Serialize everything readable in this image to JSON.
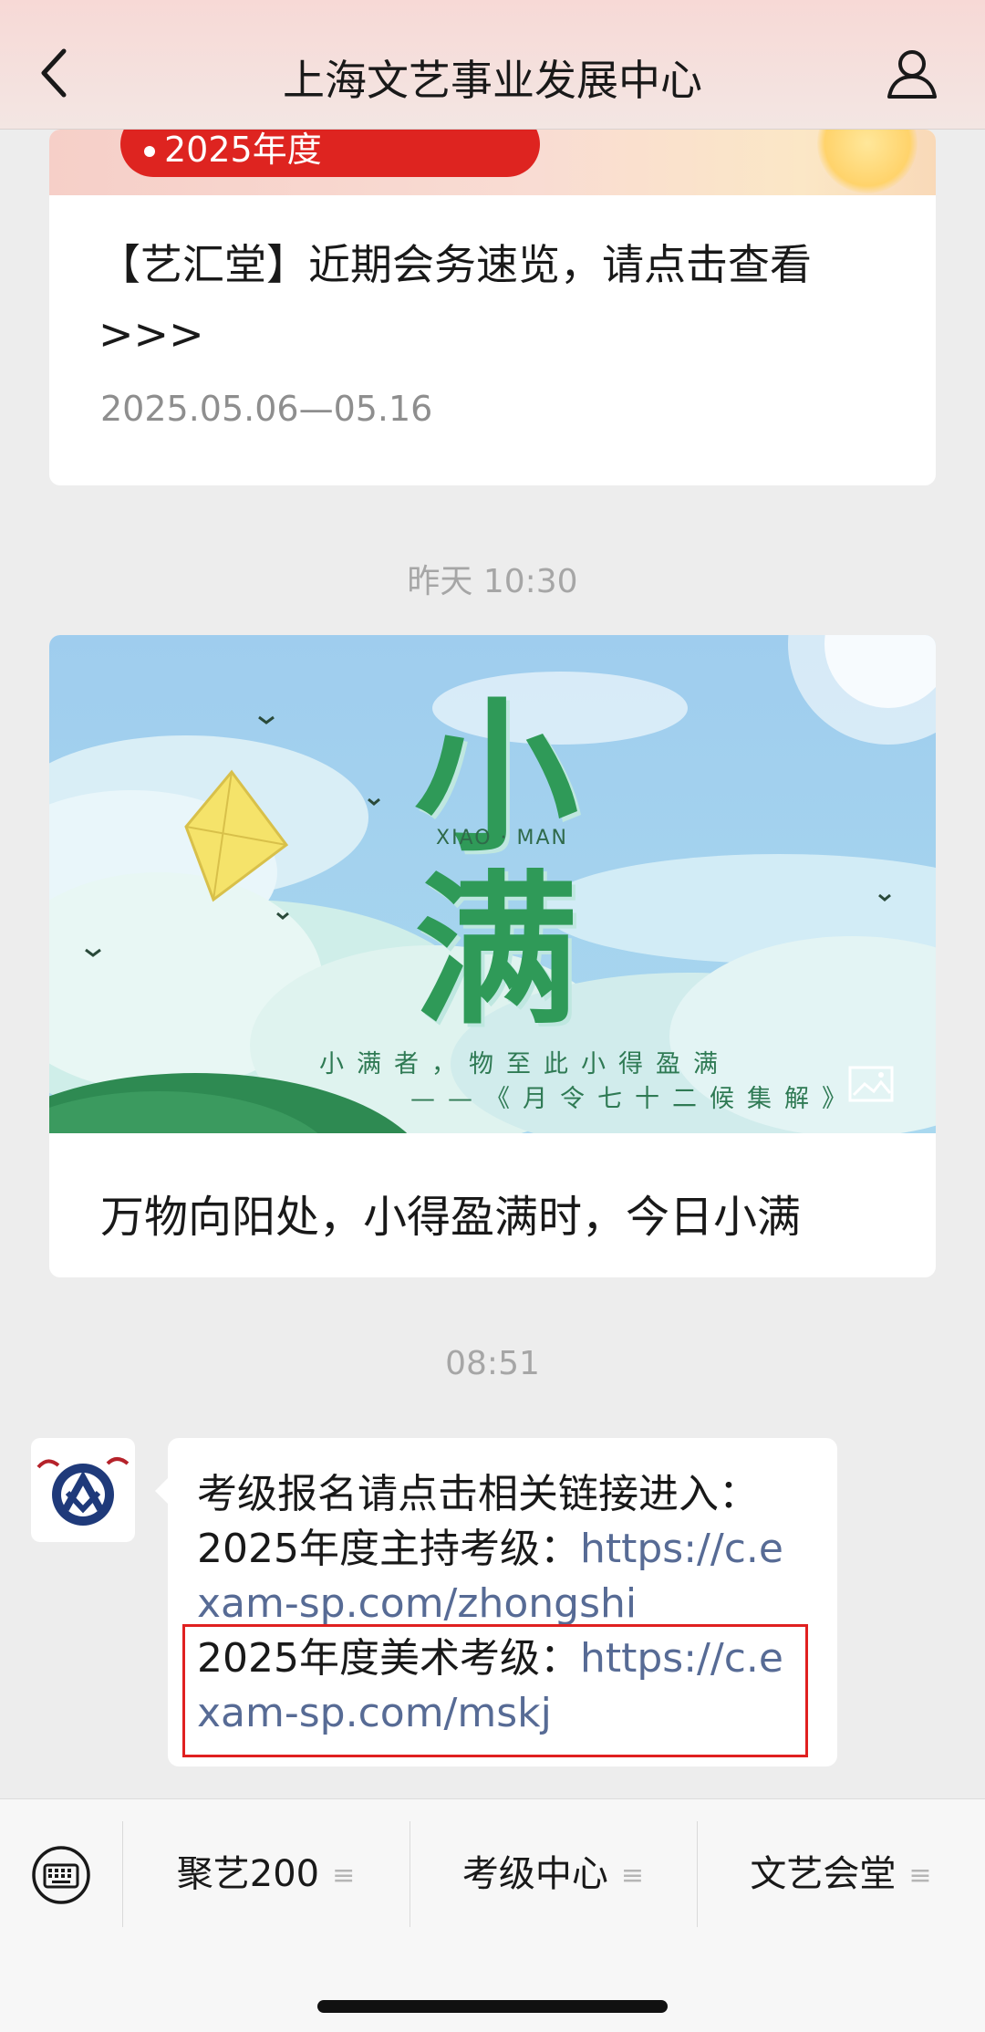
{
  "header": {
    "title": "上海文艺事业发展中心",
    "back_icon": "chevron-left-icon",
    "profile_icon": "person-icon"
  },
  "card1": {
    "banner_text": "2025年度",
    "headline_line1": "【艺汇堂】近期会务速览，请点击查看",
    "headline_line2": ">>>",
    "date": "2025.05.06—05.16"
  },
  "timestamps": {
    "first": "昨天 10:30",
    "second": "08:51"
  },
  "card2": {
    "image": {
      "char_top": "小",
      "char_bottom": "满",
      "pinyin": "XIAO · MAN",
      "quote": "小满者，物至此小得盈满",
      "source": "——《月令七十二候集解》"
    },
    "caption": "万物向阳处，小得盈满时，今日小满"
  },
  "message": {
    "line1": "考级报名请点击相关链接进入：",
    "line2_prefix": "2025年度主持考级：",
    "line2_link_part1": "https://c.e",
    "line3_link_part2": "xam-sp.com/zhongshi",
    "line4_prefix": "2025年度美术考级：",
    "line4_link_part1": "https://c.e",
    "line5_link_part2": "xam-sp.com/mskj"
  },
  "bottom_menu": {
    "keyboard_icon": "keyboard-icon",
    "items": [
      {
        "label": "聚艺200"
      },
      {
        "label": "考级中心"
      },
      {
        "label": "文艺会堂"
      }
    ],
    "menu_icon": "≡"
  },
  "colors": {
    "link": "#576b95",
    "highlight": "#e02020",
    "banner_red": "#de2420"
  }
}
